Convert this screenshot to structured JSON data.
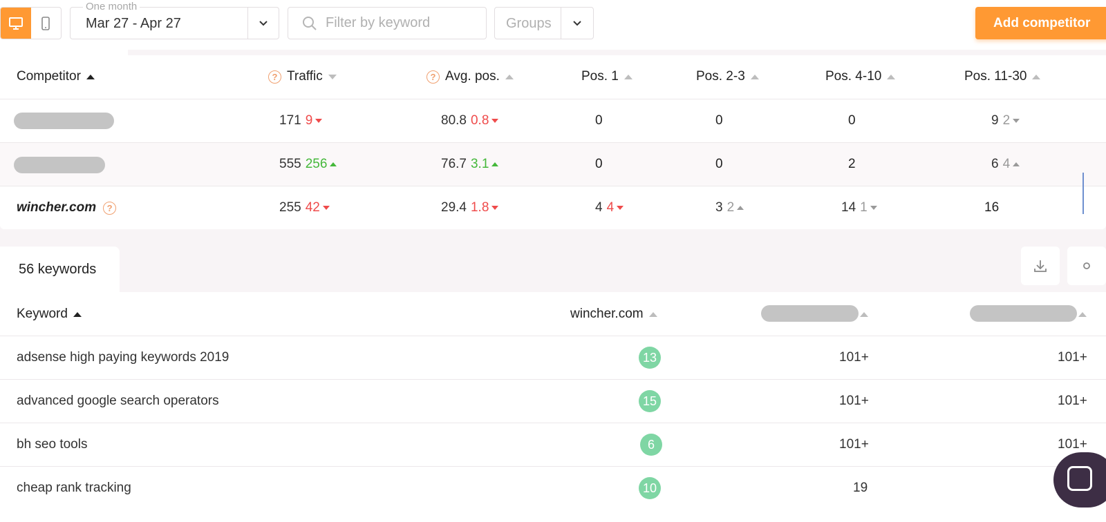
{
  "toolbar": {
    "date_range_label": "One month",
    "date_range_value": "Mar 27 - Apr 27",
    "filter_placeholder": "Filter by keyword",
    "groups_label": "Groups",
    "add_button_label": "Add competitor"
  },
  "competitors": {
    "headers": {
      "competitor": "Competitor",
      "traffic": "Traffic",
      "avg_pos": "Avg. pos.",
      "pos1": "Pos. 1",
      "pos2_3": "Pos. 2-3",
      "pos4_10": "Pos. 4-10",
      "pos11_30": "Pos. 11-30"
    },
    "rows": [
      {
        "name": "",
        "traffic": "171",
        "traffic_delta": "9",
        "avg": "80.8",
        "avg_delta": "0.8",
        "p1": "0",
        "p1_delta": "",
        "p23": "0",
        "p23_delta": "",
        "p410": "0",
        "p410_delta": "",
        "p1130": "9",
        "p1130_delta": "2"
      },
      {
        "name": "",
        "traffic": "555",
        "traffic_delta": "256",
        "avg": "76.7",
        "avg_delta": "3.1",
        "p1": "0",
        "p1_delta": "",
        "p23": "0",
        "p23_delta": "",
        "p410": "2",
        "p410_delta": "",
        "p1130": "6",
        "p1130_delta": "4"
      },
      {
        "name": "wincher.com",
        "traffic": "255",
        "traffic_delta": "42",
        "avg": "29.4",
        "avg_delta": "1.8",
        "p1": "4",
        "p1_delta": "4",
        "p23": "3",
        "p23_delta": "2",
        "p410": "14",
        "p410_delta": "1",
        "p1130": "16",
        "p1130_delta": ""
      }
    ]
  },
  "keywords": {
    "count_label": "56 keywords",
    "headers": {
      "keyword": "Keyword",
      "site": "wincher.com"
    },
    "rows": [
      {
        "keyword": "adsense high paying keywords 2019",
        "site_pos": "13",
        "c1": "101+",
        "c2": "101+"
      },
      {
        "keyword": "advanced google search operators",
        "site_pos": "15",
        "c1": "101+",
        "c2": "101+"
      },
      {
        "keyword": "bh seo tools",
        "site_pos": "6",
        "c1": "101+",
        "c2": "101+"
      },
      {
        "keyword": "cheap rank tracking",
        "site_pos": "10",
        "c1": "19",
        "c2": ""
      }
    ]
  },
  "colors": {
    "accent": "#ff9933",
    "positive": "#44b83a",
    "negative": "#ef4b4b",
    "rank_pill": "#7fd6a4"
  }
}
